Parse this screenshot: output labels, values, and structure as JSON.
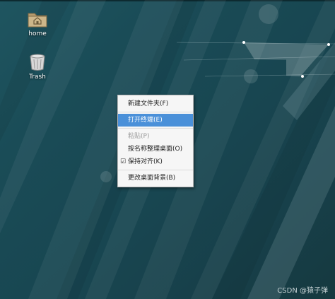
{
  "desktop": {
    "icons": [
      {
        "label": "home",
        "icon": "home-folder-icon"
      },
      {
        "label": "Trash",
        "icon": "trash-icon"
      }
    ]
  },
  "context_menu": {
    "items": [
      {
        "label": "新建文件夹(F)",
        "state": "normal"
      },
      {
        "label": "打开终端(E)",
        "state": "highlighted"
      },
      {
        "label": "粘贴(P)",
        "state": "disabled"
      },
      {
        "label": "按名称整理桌面(O)",
        "state": "normal"
      },
      {
        "label": "保持对齐(K)",
        "state": "checked"
      },
      {
        "label": "更改桌面背景(B)",
        "state": "normal"
      }
    ]
  },
  "watermark": "CSDN @猿子弹",
  "colors": {
    "menu_highlight": "#4a90d9",
    "wallpaper_base": "#1a4c57"
  }
}
